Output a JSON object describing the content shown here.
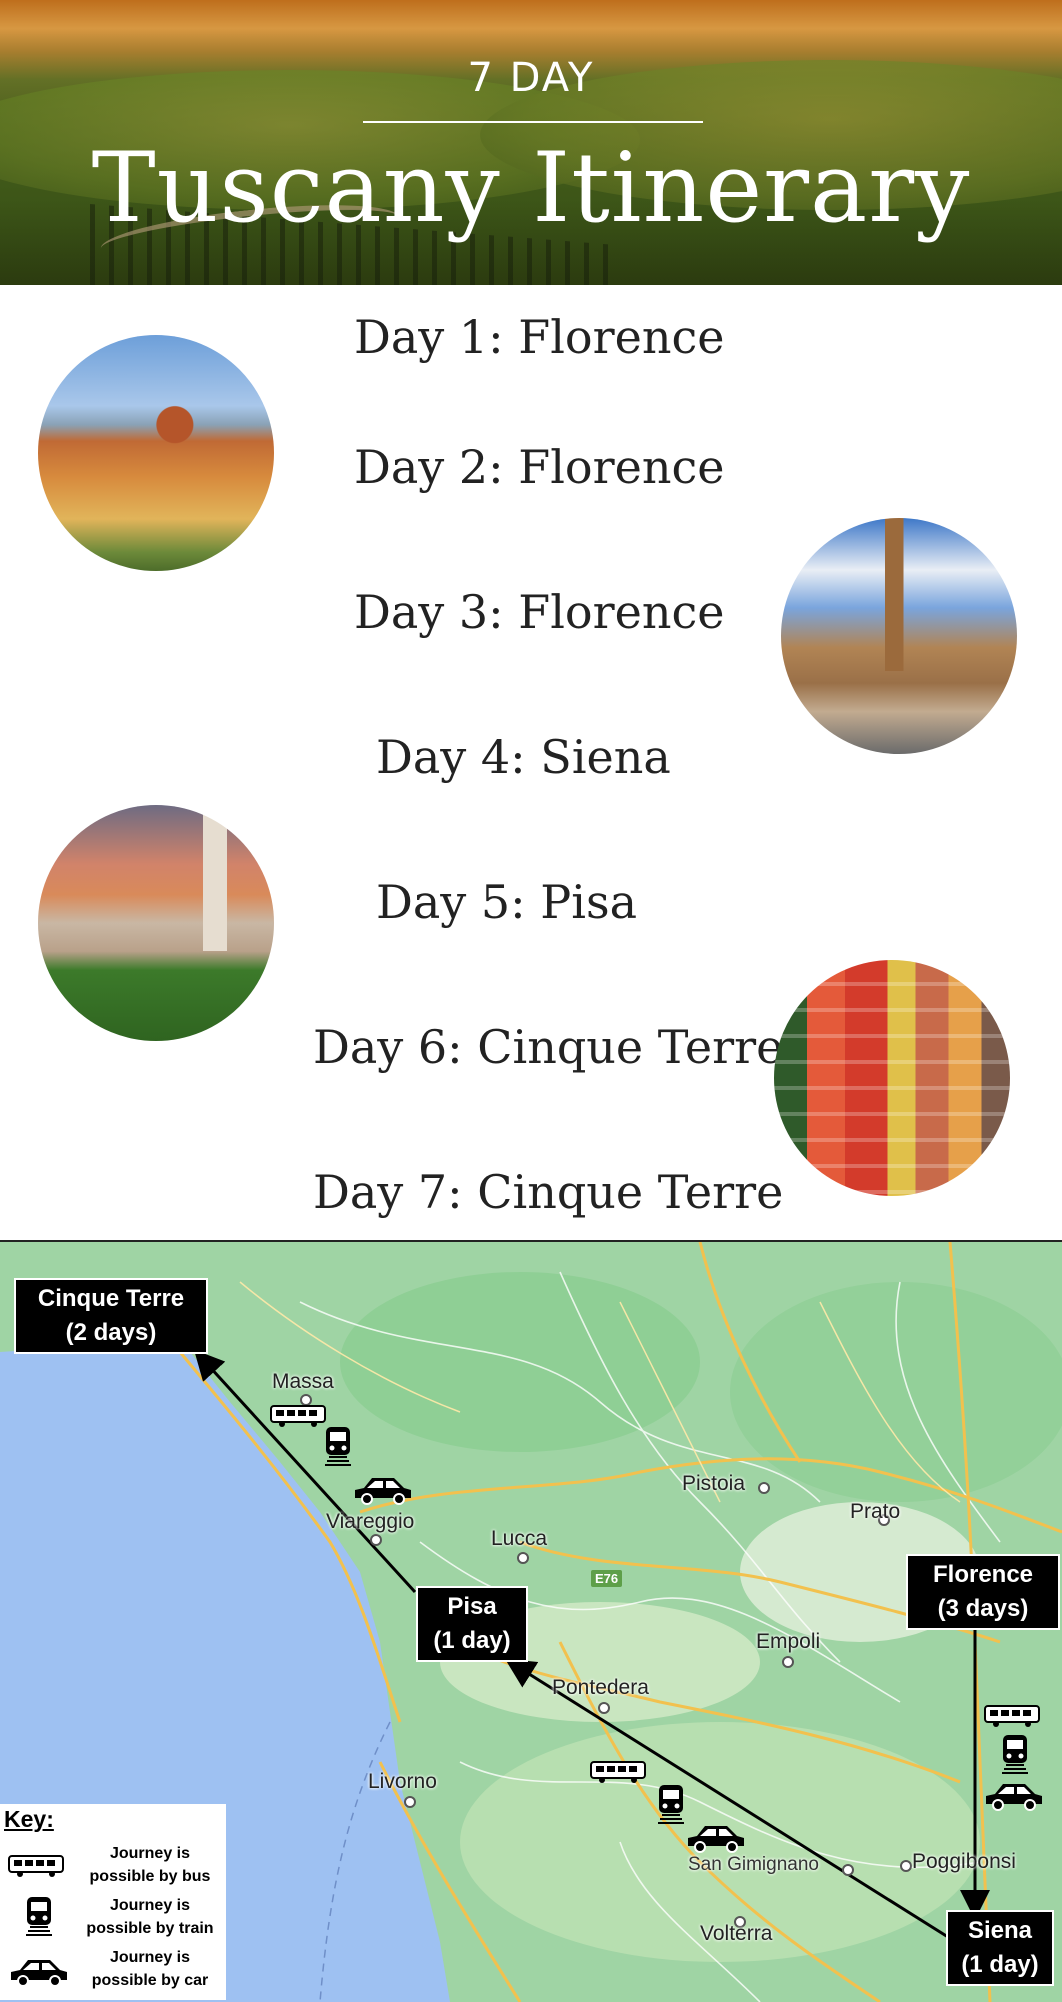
{
  "header": {
    "subtitle": "7 DAY",
    "title": "Tuscany Itinerary"
  },
  "days": [
    "Day 1: Florence",
    "Day 2: Florence",
    "Day 3: Florence",
    "Day 4: Siena",
    "Day 5: Pisa",
    "Day 6: Cinque Terre",
    "Day 7: Cinque Terre"
  ],
  "map": {
    "callouts": {
      "cinque_terre": [
        "Cinque Terre",
        "(2 days)"
      ],
      "pisa": [
        "Pisa",
        "(1 day)"
      ],
      "florence": [
        "Florence",
        "(3 days)"
      ],
      "siena": [
        "Siena",
        "(1 day)"
      ]
    },
    "towns": {
      "massa": "Massa",
      "viareggio": "Viareggio",
      "lucca": "Lucca",
      "pistoia": "Pistoia",
      "prato": "Prato",
      "empoli": "Empoli",
      "pontedera": "Pontedera",
      "livorno": "Livorno",
      "san_gimignano": "San Gimignano",
      "poggibonsi": "Poggibonsi",
      "volterra": "Volterra"
    },
    "road_shield": "E76",
    "colors": {
      "sea": "#9ec1f2",
      "land": "#a7d9a8",
      "roads": "#f2c14e",
      "callout": "#000000"
    }
  },
  "key": {
    "title": "Key:",
    "items": [
      {
        "icon": "bus-icon",
        "label": "Journey is possible by bus"
      },
      {
        "icon": "train-icon",
        "label": "Journey is possible by train"
      },
      {
        "icon": "car-icon",
        "label": "Journey is possible by car"
      }
    ]
  }
}
